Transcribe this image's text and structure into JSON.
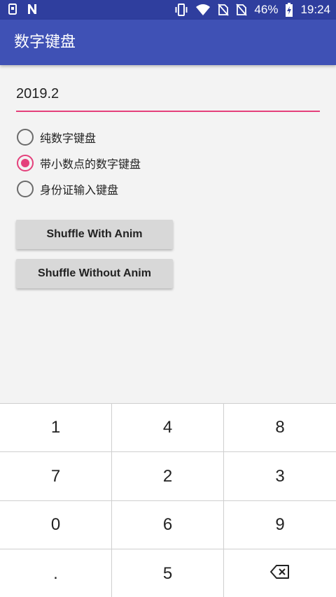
{
  "status_bar": {
    "battery_percent": "46%",
    "time": "19:24",
    "icons": [
      "sim-card-icon",
      "n-notification-icon",
      "vibrate-icon",
      "wifi-icon",
      "no-sim-icon",
      "no-sim-icon",
      "battery-charging-icon"
    ]
  },
  "app_bar": {
    "title": "数字键盘"
  },
  "input": {
    "value": "2019.2"
  },
  "radio_options": [
    {
      "label": "纯数字键盘",
      "checked": false
    },
    {
      "label": "带小数点的数字键盘",
      "checked": true
    },
    {
      "label": "身份证输入键盘",
      "checked": false
    }
  ],
  "buttons": {
    "shuffle_with_anim": "Shuffle With Anim",
    "shuffle_without_anim": "Shuffle Without Anim"
  },
  "keypad": {
    "keys": [
      "1",
      "4",
      "8",
      "7",
      "2",
      "3",
      "0",
      "6",
      "9",
      ".",
      "5"
    ],
    "delete_icon": "backspace-icon"
  },
  "colors": {
    "status_bar": "#2f3e9e",
    "app_bar": "#3f51b5",
    "accent": "#e4407b",
    "background": "#f3f3f3",
    "button": "#d8d8d8"
  }
}
